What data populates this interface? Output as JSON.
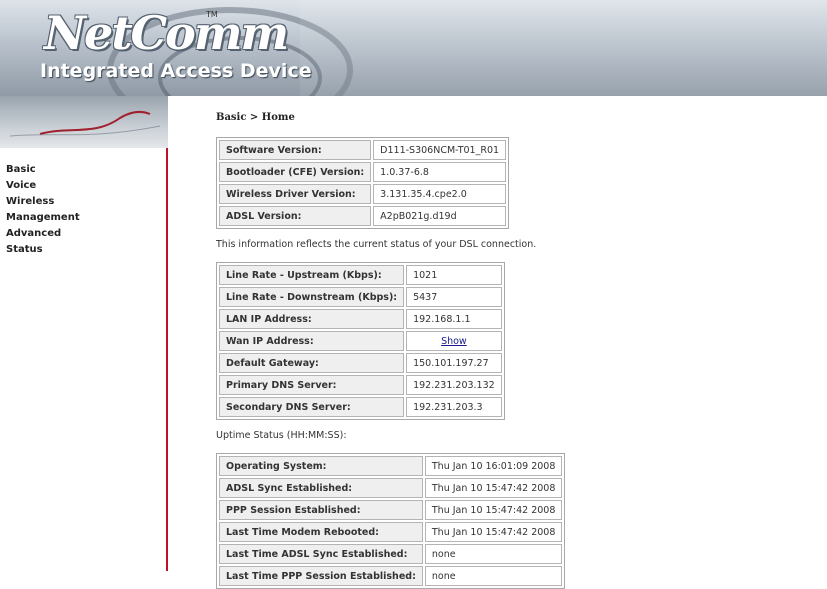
{
  "header": {
    "logo_text": "NetComm",
    "logo_tm": "TM",
    "subtitle": "Integrated Access Device"
  },
  "nav": {
    "items": [
      {
        "label": "Basic"
      },
      {
        "label": "Voice"
      },
      {
        "label": "Wireless"
      },
      {
        "label": "Management"
      },
      {
        "label": "Advanced"
      },
      {
        "label": "Status"
      }
    ]
  },
  "breadcrumb": "Basic > Home",
  "versions": [
    {
      "label": "Software Version:",
      "value": "D111-S306NCM-T01_R01"
    },
    {
      "label": "Bootloader (CFE) Version:",
      "value": "1.0.37-6.8"
    },
    {
      "label": "Wireless Driver Version:",
      "value": "3.131.35.4.cpe2.0"
    },
    {
      "label": "ADSL Version:",
      "value": "A2pB021g.d19d"
    }
  ],
  "dsl_info_text": "This information reflects the current status of your DSL connection.",
  "connection": [
    {
      "label": "Line Rate - Upstream (Kbps):",
      "value": "1021"
    },
    {
      "label": "Line Rate - Downstream (Kbps):",
      "value": "5437"
    },
    {
      "label": "LAN IP Address:",
      "value": "192.168.1.1"
    },
    {
      "label": "Wan IP Address:",
      "value": "Show"
    },
    {
      "label": "Default Gateway:",
      "value": "150.101.197.27"
    },
    {
      "label": "Primary DNS Server:",
      "value": "192.231.203.132"
    },
    {
      "label": "Secondary DNS Server:",
      "value": "192.231.203.3"
    }
  ],
  "uptime_text": "Uptime Status (HH:MM:SS):",
  "uptime": [
    {
      "label": "Operating System:",
      "value": "Thu Jan 10 16:01:09 2008"
    },
    {
      "label": "ADSL Sync Established:",
      "value": "Thu Jan 10 15:47:42 2008"
    },
    {
      "label": "PPP Session Established:",
      "value": "Thu Jan 10 15:47:42 2008"
    },
    {
      "label": "Last Time Modem Rebooted:",
      "value": "Thu Jan 10 15:47:42 2008"
    },
    {
      "label": "Last Time ADSL Sync Established:",
      "value": "none"
    },
    {
      "label": "Last Time PPP Session Established:",
      "value": "none"
    }
  ],
  "colors": {
    "sidebar_border": "#c0112b",
    "link": "#1a1a8c",
    "label_cell_bg": "#efefef"
  }
}
